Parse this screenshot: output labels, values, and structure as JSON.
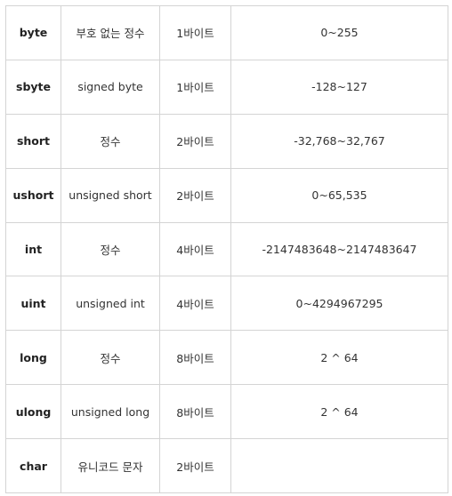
{
  "table": {
    "rows": [
      {
        "type": "byte",
        "description": "부호 없는 정수",
        "size": "1바이트",
        "range": "0~255"
      },
      {
        "type": "sbyte",
        "description": "signed byte",
        "size": "1바이트",
        "range": "-128~127"
      },
      {
        "type": "short",
        "description": "정수",
        "size": "2바이트",
        "range": "-32,768~32,767"
      },
      {
        "type": "ushort",
        "description": "unsigned short",
        "size": "2바이트",
        "range": "0~65,535"
      },
      {
        "type": "int",
        "description": "정수",
        "size": "4바이트",
        "range": "-2147483648~2147483647"
      },
      {
        "type": "uint",
        "description": "unsigned int",
        "size": "4바이트",
        "range": "0~4294967295"
      },
      {
        "type": "long",
        "description": "정수",
        "size": "8바이트",
        "range": "2 ^ 64"
      },
      {
        "type": "ulong",
        "description": "unsigned long",
        "size": "8바이트",
        "range": "2 ^ 64"
      },
      {
        "type": "char",
        "description": "유니코드 문자",
        "size": "2바이트",
        "range": ""
      }
    ]
  }
}
